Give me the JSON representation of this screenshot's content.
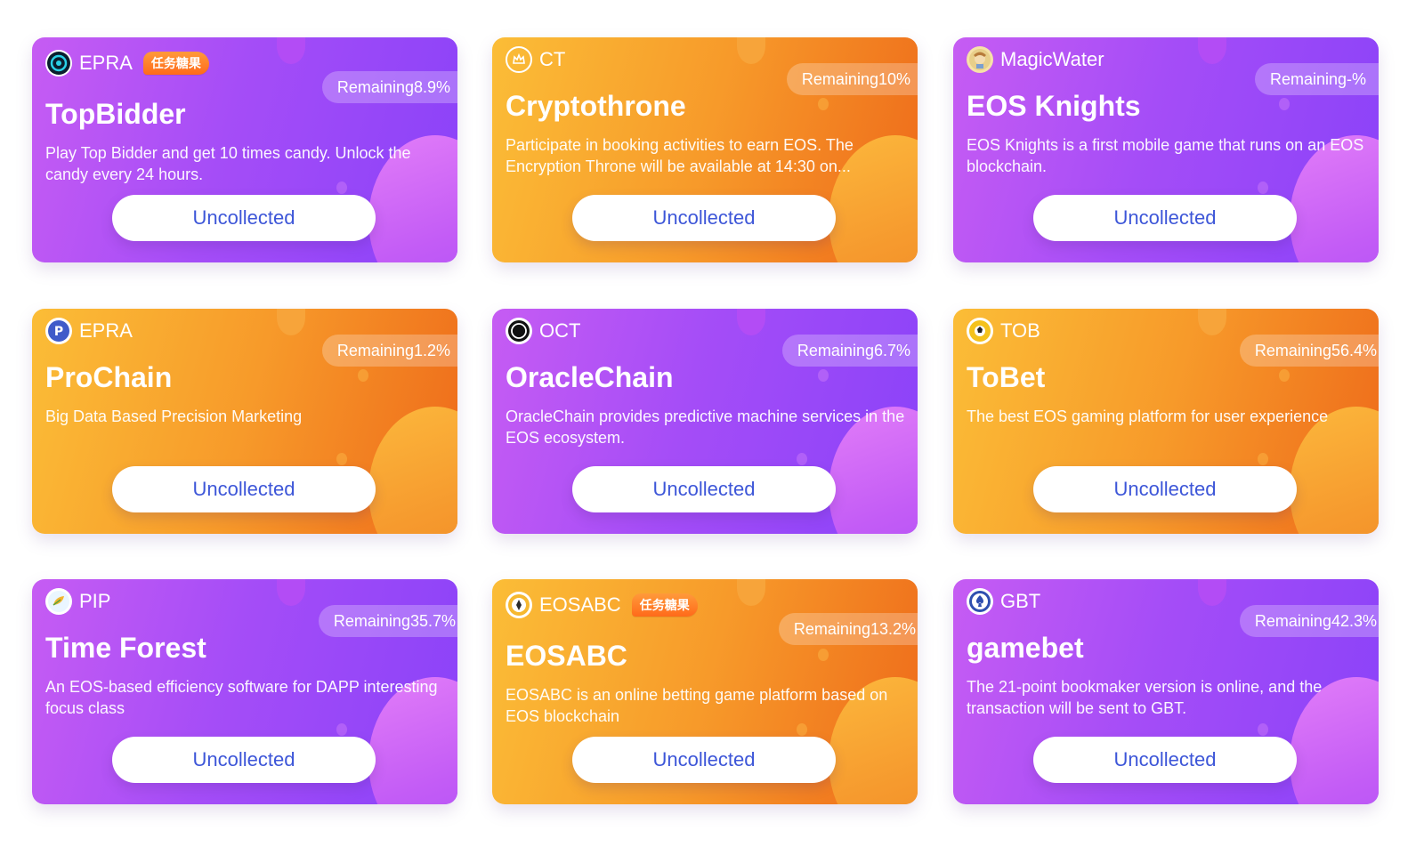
{
  "cards": [
    {
      "symbol": "EPRA",
      "tag": "任务糖果",
      "remaining": "Remaining8.9%",
      "title": "TopBidder",
      "description": "Play Top Bidder and get 10 times candy. Unlock the candy every 24 hours.",
      "button": "Uncollected",
      "theme": "purple",
      "icon": "epra-swirl-icon"
    },
    {
      "symbol": "CT",
      "remaining": "Remaining10%",
      "title": "Cryptothrone",
      "description": "Participate in booking activities to earn EOS. The Encryption Throne will be available at 14:30 on...",
      "button": "Uncollected",
      "theme": "orange",
      "icon": "crown-coin-icon"
    },
    {
      "symbol": "MagicWater",
      "remaining": "Remaining-%",
      "title": "EOS Knights",
      "description": "EOS Knights is a first mobile game that runs on an EOS blockchain.",
      "button": "Uncollected",
      "theme": "purple",
      "icon": "knight-avatar-icon"
    },
    {
      "symbol": "EPRA",
      "remaining": "Remaining1.2%",
      "title": "ProChain",
      "description": "Big Data Based Precision Marketing",
      "button": "Uncollected",
      "theme": "orange",
      "icon": "prochain-p-icon"
    },
    {
      "symbol": "OCT",
      "remaining": "Remaining6.7%",
      "title": "OracleChain",
      "description": "OracleChain provides predictive machine services in the EOS ecosystem.",
      "button": "Uncollected",
      "theme": "purple",
      "icon": "oracle-ring-icon"
    },
    {
      "symbol": "TOB",
      "remaining": "Remaining56.4%",
      "title": "ToBet",
      "description": "The best EOS gaming platform for user experience",
      "button": "Uncollected",
      "theme": "orange",
      "icon": "tobet-ball-icon"
    },
    {
      "symbol": "PIP",
      "remaining": "Remaining35.7%",
      "title": "Time Forest",
      "description": "An EOS-based efficiency software for DAPP interesting focus class",
      "button": "Uncollected",
      "theme": "purple",
      "icon": "forest-leaf-icon"
    },
    {
      "symbol": "EOSABC",
      "tag": "任务糖果",
      "remaining": "Remaining13.2%",
      "title": "EOSABC",
      "description": "EOSABC is an online betting game platform based on EOS blockchain",
      "button": "Uncollected",
      "theme": "orange",
      "icon": "eosabc-coin-icon"
    },
    {
      "symbol": "GBT",
      "remaining": "Remaining42.3%",
      "title": "gamebet",
      "description": "The 21-point bookmaker version is online, and the transaction will be sent to GBT.",
      "button": "Uncollected",
      "theme": "purple",
      "icon": "gamebet-spade-icon"
    }
  ]
}
